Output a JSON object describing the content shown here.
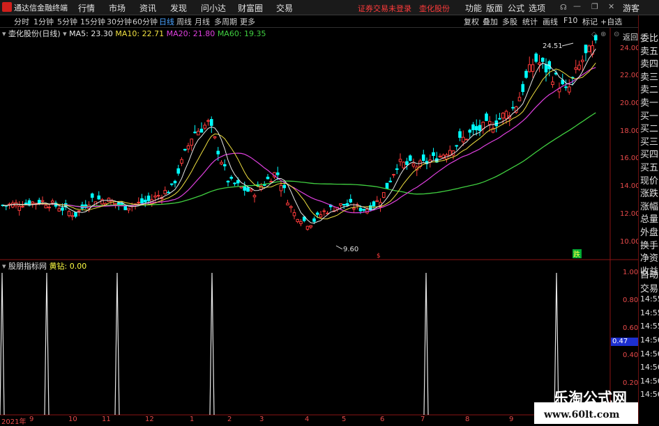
{
  "app": {
    "title": "通达信金融终端",
    "warning": "证券交易未登录　壶化股份"
  },
  "menu": [
    "行情",
    "市场",
    "资讯",
    "发现",
    "问小达",
    "财富圈",
    "交易"
  ],
  "menu_right": [
    "功能",
    "版面",
    "公式",
    "选项",
    "游客"
  ],
  "tabs": [
    "分时",
    "1分钟",
    "5分钟",
    "15分钟",
    "30分钟",
    "60分钟",
    "日线",
    "周线",
    "月线",
    "多周期",
    "更多"
  ],
  "active_tab": "日线",
  "toolbar": [
    "复权",
    "叠加",
    "多股",
    "统计",
    "画线",
    "F10",
    "标记",
    "+自选",
    "返回"
  ],
  "main": {
    "stock_label": "壶化股份(日线)",
    "ma": [
      {
        "label": "MA5: 23.30",
        "color": "#e8e8e8"
      },
      {
        "label": "MA10: 22.71",
        "color": "#f0e040"
      },
      {
        "label": "MA20: 21.80",
        "color": "#e040e0"
      },
      {
        "label": "MA60: 19.35",
        "color": "#40d040"
      }
    ],
    "high_label": "24.51",
    "low_label": "9.60",
    "signal_down": "跌",
    "price_axis": [
      "24.00",
      "22.00",
      "20.00",
      "18.00",
      "16.00",
      "14.00",
      "12.00",
      "10.00"
    ]
  },
  "indicator": {
    "name": "股朋指标网",
    "label": "黄钻: 0.00",
    "axis": [
      "1.00",
      "0.80",
      "0.60",
      "0.40",
      "0.20"
    ],
    "current_value": "0.47"
  },
  "right_panel": [
    "委比",
    "卖五",
    "卖四",
    "卖三",
    "卖二",
    "卖一",
    "买一",
    "买二",
    "买三",
    "买四",
    "买五",
    "现价",
    "涨跌",
    "涨幅",
    "总量",
    "外盘",
    "换手",
    "净资",
    "收益"
  ],
  "right_panel_lower": [
    "自动",
    "交易",
    "14:55",
    "14:55",
    "14:55",
    "14:56",
    "14:56",
    "14:56",
    "14:56",
    "14:56"
  ],
  "x_axis": [
    "2021年",
    "9",
    "10",
    "11",
    "12",
    "1",
    "2",
    "3",
    "4",
    "5",
    "6",
    "7",
    "8",
    "9"
  ],
  "watermark": {
    "title": "乐淘公式网",
    "url": "www.60lt.com"
  },
  "colors": {
    "up": "#ff3b3b",
    "down": "#00ffff",
    "ma5": "#e8e8e8",
    "ma10": "#f0e040",
    "ma20": "#e040e0",
    "ma60": "#40d040",
    "axis": "#e84a4a",
    "active": "#4aa3ff"
  }
}
